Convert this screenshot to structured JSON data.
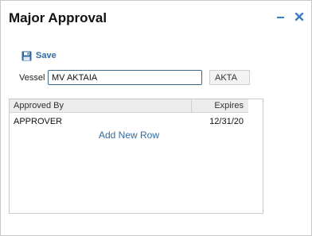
{
  "window": {
    "title": "Major Approval"
  },
  "toolbar": {
    "save_label": "Save"
  },
  "form": {
    "vessel_label": "Vessel",
    "vessel_value": "MV AKTAIA",
    "vessel_code": "AKTA"
  },
  "grid": {
    "columns": [
      "Approved By",
      "Expires"
    ],
    "rows": [
      {
        "approved_by": "APPROVER",
        "expires": "12/31/20"
      }
    ],
    "add_row_label": "Add New Row"
  },
  "colors": {
    "accent": "#2f6ba0",
    "input_border": "#3d6a88",
    "header_bg": "#ececec"
  },
  "icons": [
    "minimize-icon",
    "close-icon",
    "save-icon"
  ]
}
